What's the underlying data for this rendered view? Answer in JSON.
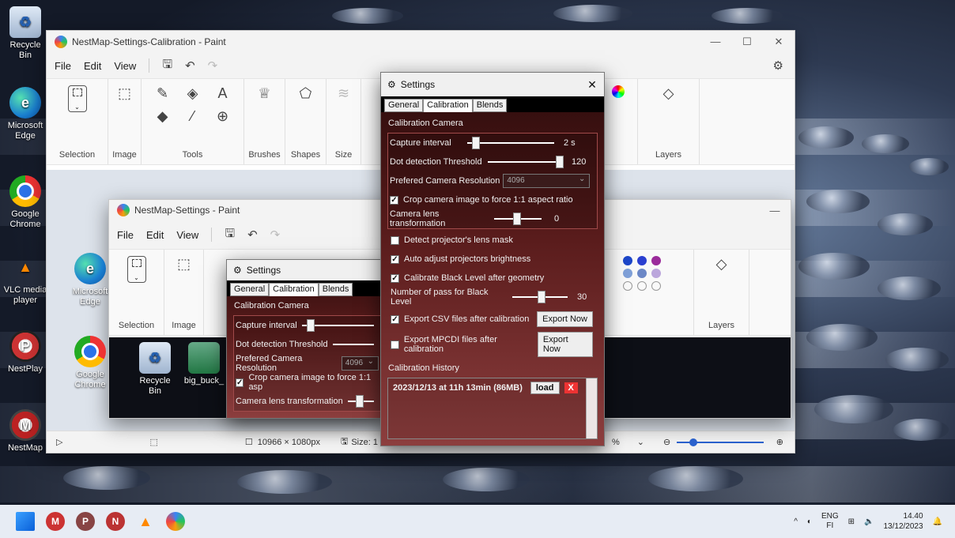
{
  "desktop": {
    "icons": [
      {
        "label": "Recycle Bin"
      },
      {
        "label": "Microsoft Edge"
      },
      {
        "label": "Google Chrome"
      },
      {
        "label": "VLC media player"
      },
      {
        "label": "NestPlay"
      },
      {
        "label": "NestMap"
      }
    ]
  },
  "paint_back": {
    "title": "NestMap-Settings-Calibration - Paint",
    "menu": [
      "File",
      "Edit",
      "View"
    ],
    "ribbon": {
      "selection": "Selection",
      "image": "Image",
      "tools": "Tools",
      "brushes": "Brushes",
      "shapes": "Shapes",
      "size": "Size",
      "layers": "Layers"
    },
    "status": {
      "dimensions": "10966 × 1080px",
      "size": "Size: 1",
      "zoom": "%"
    },
    "window_controls": [
      "—",
      "☐",
      "✕"
    ]
  },
  "paint_front": {
    "title": "NestMap-Settings - Paint",
    "menu": [
      "File",
      "Edit",
      "View"
    ],
    "ribbon": {
      "selection": "Selection",
      "image": "Image",
      "layers": "Layers"
    },
    "canvas_icons": [
      {
        "label": "Microsoft Edge"
      },
      {
        "label": "Google Chrome"
      },
      {
        "label": "Recycle Bin"
      },
      {
        "label": "big_buck_"
      }
    ]
  },
  "settings_main": {
    "title": "Settings",
    "close": "✕",
    "tabs": [
      "General",
      "Calibration",
      "Blends"
    ],
    "active_tab": "Calibration",
    "section_title": "Calibration Camera",
    "capture_interval": {
      "label": "Capture interval",
      "value": "2 s",
      "fraction": 0.08
    },
    "dot_threshold": {
      "label": "Dot detection Threshold",
      "value": "120",
      "fraction": 0.95
    },
    "resolution": {
      "label": "Prefered Camera Resolution",
      "value": "4096"
    },
    "crop": {
      "label": "Crop camera image to force 1:1 aspect ratio",
      "checked": true
    },
    "lens": {
      "label": "Camera lens transformation",
      "value": "0",
      "fraction": 0.5
    },
    "projector_mask": {
      "label": "Detect projector's lens mask",
      "checked": false
    },
    "auto_brightness": {
      "label": "Auto adjust projectors brightness",
      "checked": true
    },
    "black_level": {
      "label": "Calibrate Black Level after geometry",
      "checked": true
    },
    "black_passes": {
      "label": "Number of pass for Black Level",
      "value": "30",
      "fraction": 0.45
    },
    "export_csv": {
      "label": "Export CSV files after calibration",
      "checked": true,
      "button": "Export Now"
    },
    "export_mpcdi": {
      "label": "Export MPCDI files after calibration",
      "checked": false,
      "button": "Export Now"
    },
    "history_title": "Calibration History",
    "history": [
      {
        "entry": "2023/12/13 at 11h 13min (86MB)",
        "load": "load",
        "delete": "X"
      }
    ]
  },
  "settings_back": {
    "title": "Settings",
    "tabs": [
      "General",
      "Calibration",
      "Blends"
    ],
    "section_title": "Calibration Camera",
    "capture_interval": "Capture interval",
    "dot_threshold": "Dot detection Threshold",
    "resolution": "Prefered Camera Resolution",
    "resolution_value": "4096",
    "crop": "Crop camera image to force 1:1 asp",
    "lens": "Camera lens transformation"
  },
  "taskbar": {
    "lang": "ENG",
    "region": "FI",
    "time": "14.40",
    "date": "13/12/2023"
  }
}
